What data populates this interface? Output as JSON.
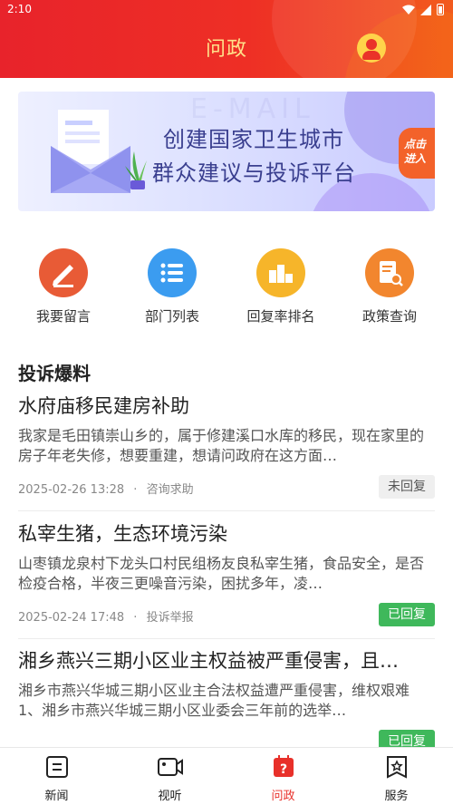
{
  "status_bar": {
    "time": "2:10"
  },
  "header": {
    "title": "问政"
  },
  "banner": {
    "line1": "创建国家卫生城市",
    "line2": "群众建议与投诉平台",
    "enter_line1": "点击",
    "enter_line2": "进入",
    "bg_text": "E-MAIL"
  },
  "actions": [
    {
      "label": "我要留言",
      "icon": "pen-icon",
      "color": "#e85b36"
    },
    {
      "label": "部门列表",
      "icon": "list-icon",
      "color": "#3b9cf0"
    },
    {
      "label": "回复率排名",
      "icon": "podium-icon",
      "color": "#f6b52a"
    },
    {
      "label": "政策查询",
      "icon": "policy-search-icon",
      "color": "#f2862e"
    }
  ],
  "section": {
    "title": "投诉爆料"
  },
  "complaints": [
    {
      "title": "水府庙移民建房补助",
      "desc": "我家是毛田镇崇山乡的，属于修建溪口水库的移民，现在家里的房子年老失修，想要重建，想请问政府在这方面…",
      "date": "2025-02-26 13:28",
      "sep": "·",
      "category": "咨询求助",
      "status": "未回复",
      "status_color": "#efefef"
    },
    {
      "title": "私宰生猪，生态环境污染",
      "desc": "山枣镇龙泉村下龙头口村民组杨友良私宰生猪，食品安全，是否检疫合格，半夜三更噪音污染，困扰多年，凌…",
      "date": "2025-02-24 17:48",
      "sep": "·",
      "category": "投诉举报",
      "status": "已回复",
      "status_color": "#3fb85b"
    },
    {
      "title": "湘乡燕兴三期小区业主权益被严重侵害，且…",
      "desc": "湘乡市燕兴华城三期小区业主合法权益遭严重侵害，维权艰难 1、湘乡市燕兴华城三期小区业委会三年前的选举…",
      "date": "",
      "sep": "",
      "category": "",
      "status": "已回复",
      "status_color": "#3fb85b"
    }
  ],
  "bottom_nav": [
    {
      "label": "新闻",
      "icon": "news-icon"
    },
    {
      "label": "视听",
      "icon": "video-icon"
    },
    {
      "label": "问政",
      "icon": "inquiry-icon",
      "active": true
    },
    {
      "label": "服务",
      "icon": "service-icon"
    }
  ],
  "colors": {
    "primary": "#e8232b",
    "header_text": "#ffe08a",
    "replied": "#3fb85b"
  }
}
